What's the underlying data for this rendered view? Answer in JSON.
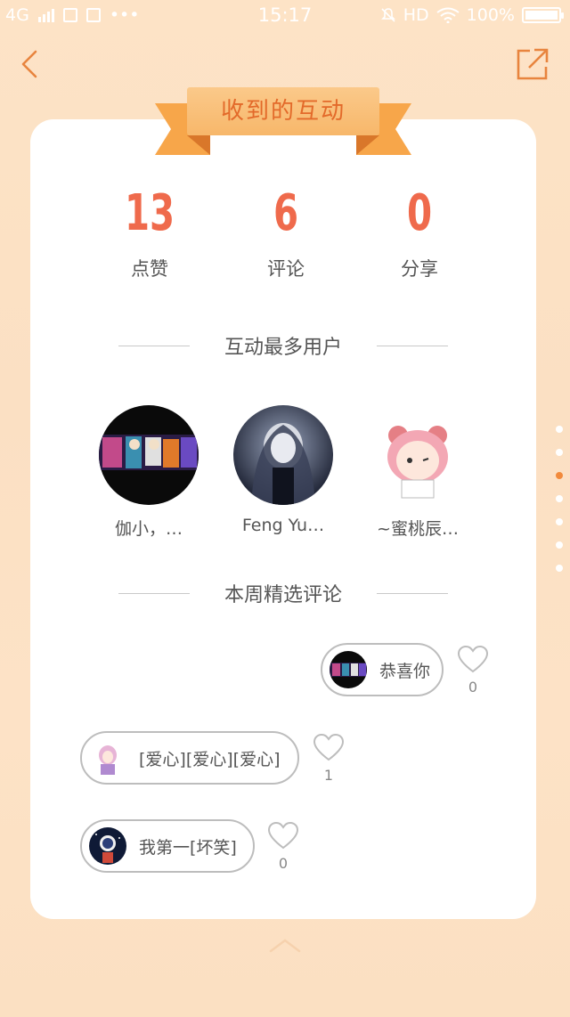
{
  "status_bar": {
    "network": "4G",
    "time": "15:17",
    "hd": "HD",
    "battery": "100%"
  },
  "header": {
    "back_icon": "chevron-left-icon",
    "share_icon": "share-external-icon"
  },
  "banner_title": "收到的互动",
  "stats": [
    {
      "value": "13",
      "label": "点赞"
    },
    {
      "value": "6",
      "label": "评论"
    },
    {
      "value": "0",
      "label": "分享"
    }
  ],
  "top_users_title": "互动最多用户",
  "top_users": [
    {
      "name": "伽小，…"
    },
    {
      "name": "Feng Yu…"
    },
    {
      "name": "~蜜桃辰…"
    }
  ],
  "comments_title": "本周精选评论",
  "comments": [
    {
      "text": "恭喜你",
      "likes": "0"
    },
    {
      "text": "[爱心][爱心][爱心]",
      "likes": "1"
    },
    {
      "text": "我第一[坏笑]",
      "likes": "0"
    }
  ],
  "colors": {
    "accent": "#ef6a4c",
    "ribbon": "#f7b76a",
    "ribbon_text": "#e36a2a",
    "background": "#fde3c6",
    "active_dot": "#f28a3c"
  },
  "pager": {
    "total": 7,
    "active_index": 2
  }
}
